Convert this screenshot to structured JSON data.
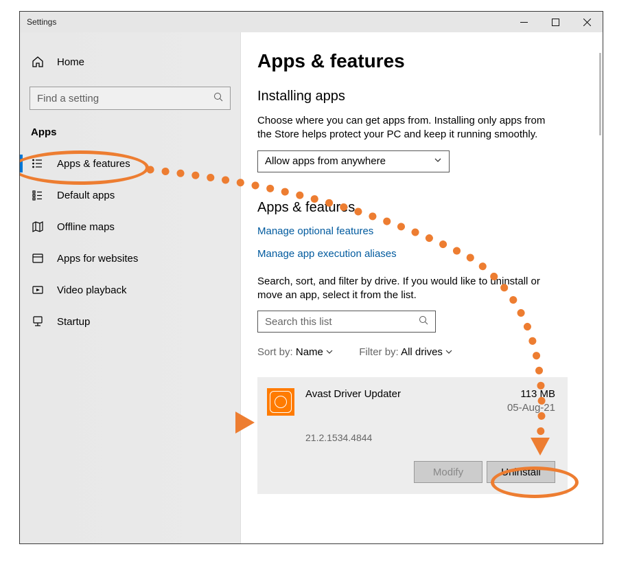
{
  "window": {
    "title": "Settings"
  },
  "sidebar": {
    "home_label": "Home",
    "search_placeholder": "Find a setting",
    "section_label": "Apps",
    "items": [
      {
        "label": "Apps & features",
        "selected": true
      },
      {
        "label": "Default apps"
      },
      {
        "label": "Offline maps"
      },
      {
        "label": "Apps for websites"
      },
      {
        "label": "Video playback"
      },
      {
        "label": "Startup"
      }
    ]
  },
  "main": {
    "page_title": "Apps & features",
    "installing_heading": "Installing apps",
    "installing_body": "Choose where you can get apps from. Installing only apps from the Store helps protect your PC and keep it running smoothly.",
    "source_select": "Allow apps from anywhere",
    "subsection_heading": "Apps & features",
    "link_optional": "Manage optional features",
    "link_aliases": "Manage app execution aliases",
    "search_body": "Search, sort, and filter by drive. If you would like to uninstall or move an app, select it from the list.",
    "search_placeholder": "Search this list",
    "sort_label": "Sort by:",
    "sort_value": "Name",
    "filter_label": "Filter by:",
    "filter_value": "All drives",
    "app": {
      "name": "Avast Driver Updater",
      "version": "21.2.1534.4844",
      "size": "113 MB",
      "date": "05-Aug-21",
      "modify_label": "Modify",
      "uninstall_label": "Uninstall"
    }
  }
}
